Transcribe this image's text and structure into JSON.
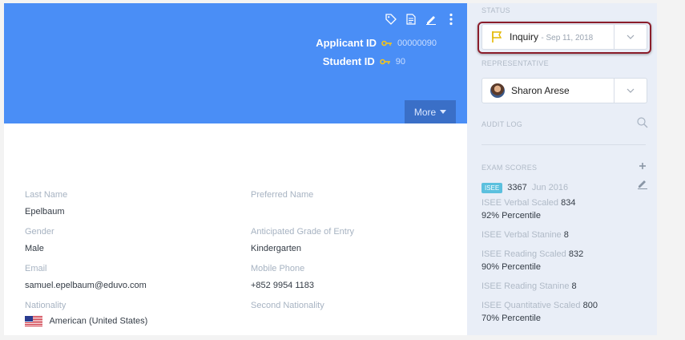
{
  "header": {
    "applicant_id_label": "Applicant ID",
    "applicant_id": "00000090",
    "student_id_label": "Student ID",
    "student_id": "90",
    "more_label": "More",
    "tool_icons": [
      "tag-icon",
      "document-icon",
      "edit-icon",
      "more-vert-icon"
    ],
    "banner_color": "#4a8ef6"
  },
  "profile": {
    "last_name_label": "Last Name",
    "last_name": "Epelbaum",
    "preferred_name_label": "Preferred Name",
    "preferred_name": "",
    "gender_label": "Gender",
    "gender": "Male",
    "grade_label": "Anticipated Grade of Entry",
    "grade": "Kindergarten",
    "email_label": "Email",
    "email": "samuel.epelbaum@eduvo.com",
    "mobile_label": "Mobile Phone",
    "mobile": "+852 9954 1183",
    "nationality_label": "Nationality",
    "nationality": "American (United States)",
    "second_nationality_label": "Second Nationality",
    "second_nationality": ""
  },
  "sidebar": {
    "status_label": "STATUS",
    "status_value": "Inquiry",
    "status_date": "- Sep 11, 2018",
    "representative_label": "REPRESENTATIVE",
    "representative": "Sharon Arese",
    "audit_log_label": "AUDIT LOG",
    "exam_scores_label": "EXAM SCORES",
    "exam": {
      "badge": "ISEE",
      "total": "3367",
      "date": "Jun 2016"
    },
    "scores": [
      {
        "name": "ISEE Verbal Scaled",
        "value": "834",
        "sub": "92% Percentile"
      },
      {
        "name": "ISEE Verbal Stanine",
        "value": "8",
        "sub": ""
      },
      {
        "name": "ISEE Reading Scaled",
        "value": "832",
        "sub": "90% Percentile"
      },
      {
        "name": "ISEE Reading Stanine",
        "value": "8",
        "sub": ""
      },
      {
        "name": "ISEE Quantitative Scaled",
        "value": "800",
        "sub": "70% Percentile"
      }
    ],
    "highlight_color": "#8b1d2b"
  }
}
